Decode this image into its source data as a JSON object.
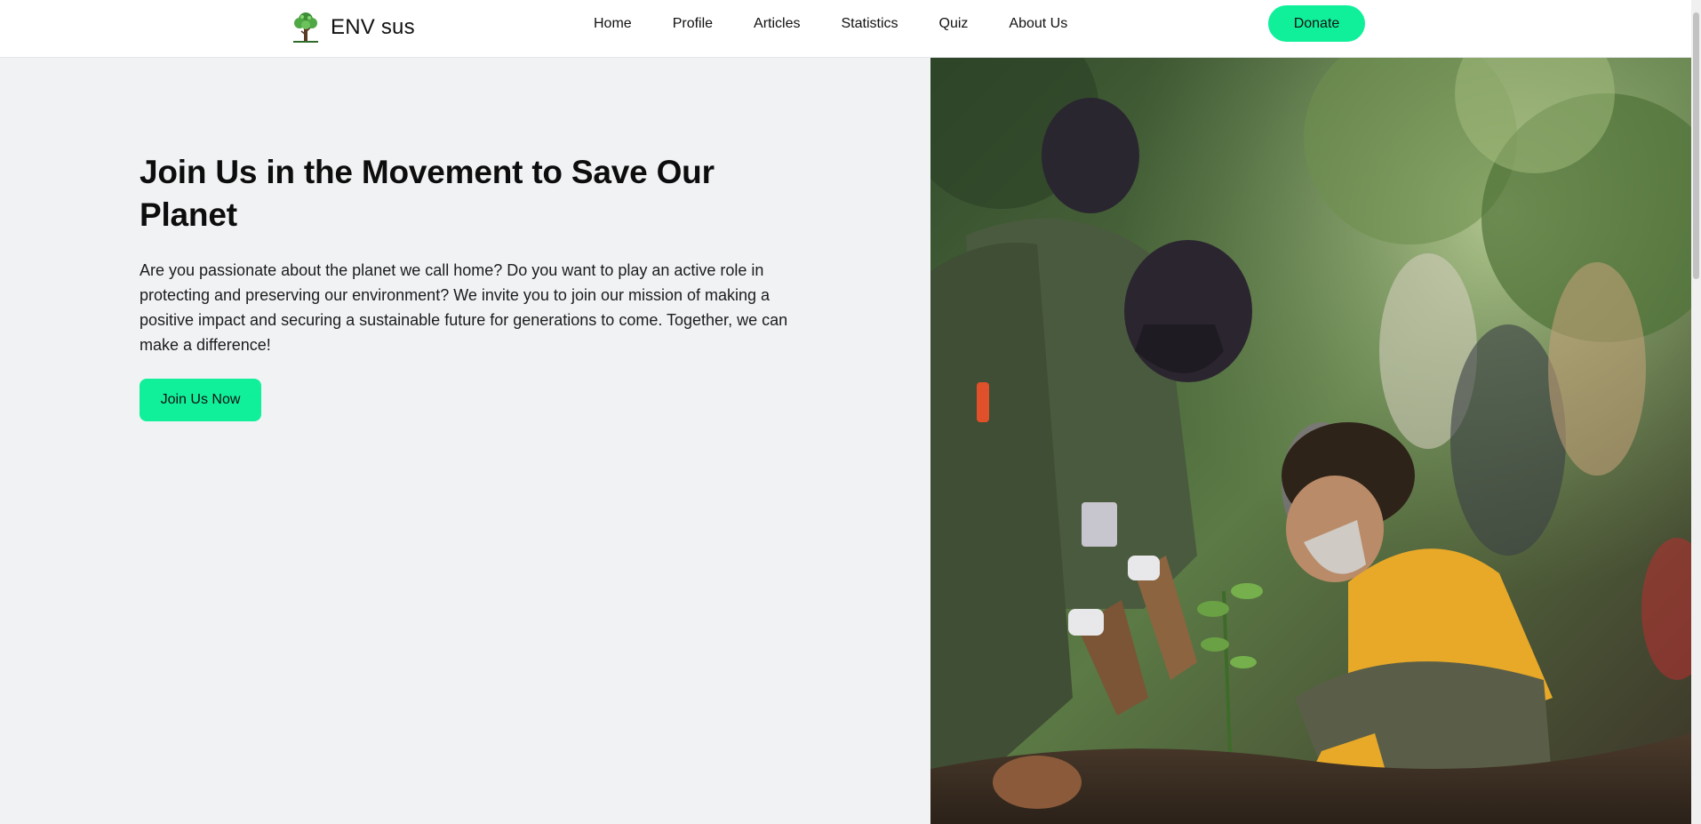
{
  "header": {
    "brand_name": "ENV sus",
    "logo_icon": "tree-icon",
    "nav": [
      {
        "label": "Home"
      },
      {
        "label": "Profile"
      },
      {
        "label": "Articles"
      },
      {
        "label": "Statistics"
      },
      {
        "label": "Quiz"
      },
      {
        "label": "About Us"
      }
    ],
    "donate_label": "Donate"
  },
  "hero": {
    "title": "Join Us in the Movement to Save Our Planet",
    "description": "Are you passionate about the planet we call home? Do you want to play an active role in protecting and preserving our environment? We invite you to join our mission of making a positive impact and securing a sustainable future for generations to come. Together, we can make a difference!",
    "cta_label": "Join Us Now"
  },
  "colors": {
    "accent": "#10f09a",
    "page_background": "#f1f2f4",
    "header_background": "#ffffff"
  }
}
